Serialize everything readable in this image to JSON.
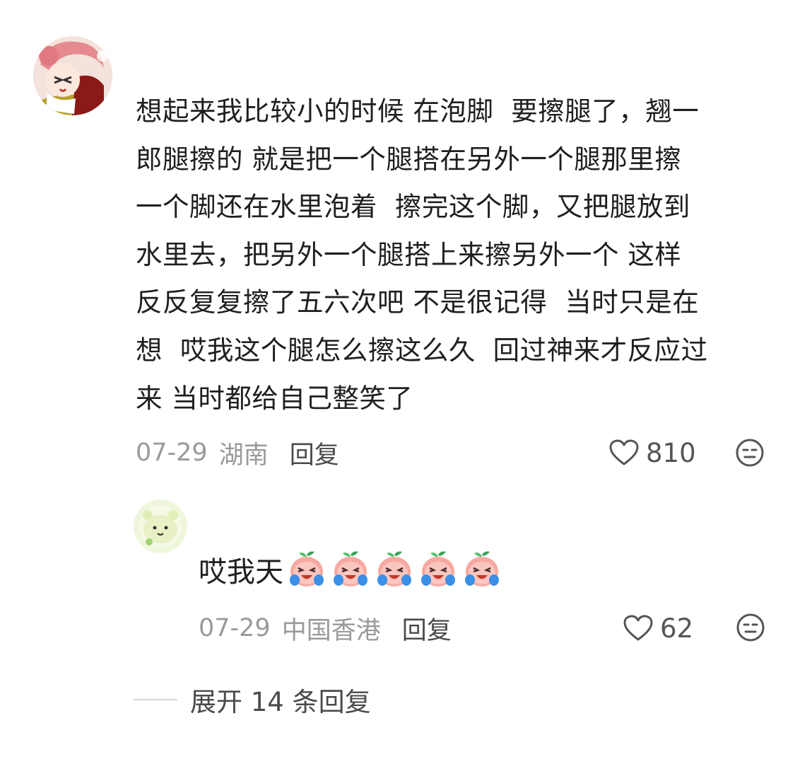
{
  "comment": {
    "text": "想起来我比较小的时候 在泡脚  要擦腿了，翘一\n郎腿擦的 就是把一个腿搭在另外一个腿那里擦\n一个脚还在水里泡着  擦完这个脚，又把腿放到\n水里去，把另外一个腿搭上来擦另外一个 这样\n反反复复擦了五六次吧 不是很记得  当时只是在\n想  哎我这个腿怎么擦这么久  回过神来才反应过\n来 当时都给自己整笑了",
    "date": "07-29",
    "location": "湖南",
    "reply_label": "回复",
    "likes": "810"
  },
  "reply": {
    "text": "哎我天",
    "emoji_count": 5,
    "emoji_name": "crying-peach-emoji",
    "date": "07-29",
    "location": "中国香港",
    "reply_label": "回复",
    "likes": "62"
  },
  "expand_label": "展开 14 条回复",
  "colors": {
    "text": "#1f1f1f",
    "meta": "#9a9a9a",
    "action": "#4a4a4a",
    "background": "#ffffff"
  }
}
